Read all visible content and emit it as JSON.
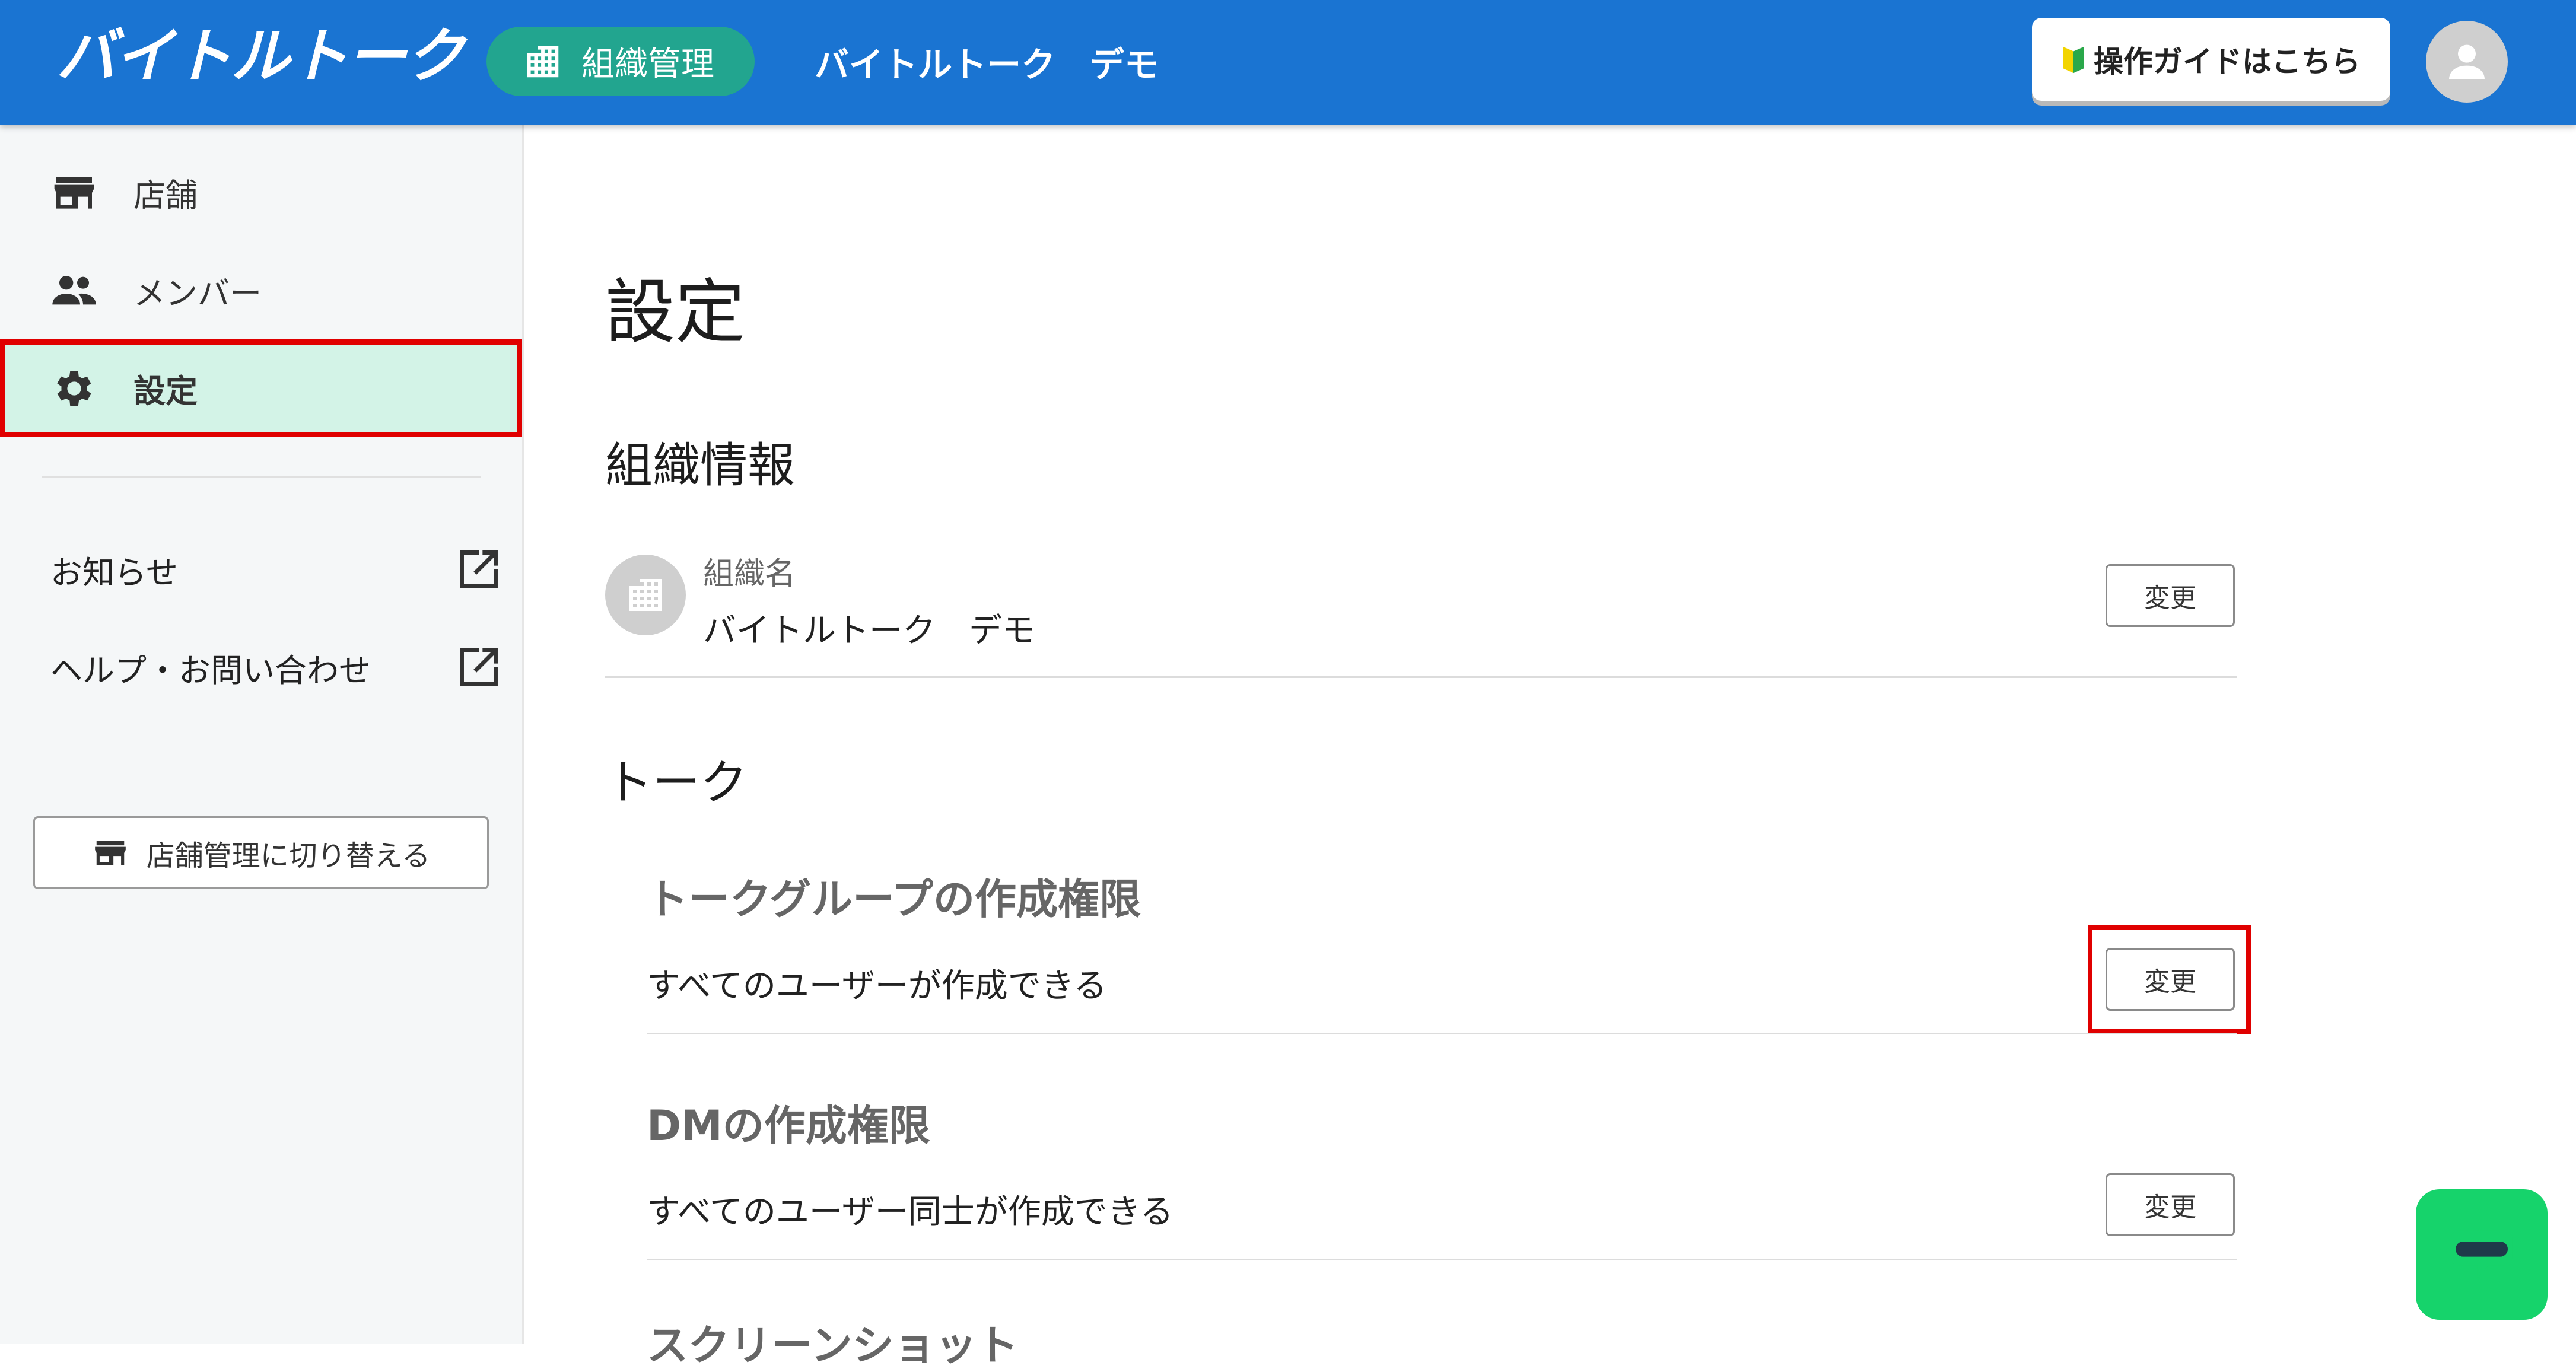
{
  "header": {
    "logo_text": "バイトルトーク",
    "org_pill_label": "組織管理",
    "org_name": "バイトルトーク　デモ",
    "guide_button_label": "操作ガイドはこちら"
  },
  "sidebar": {
    "items": [
      {
        "label": "店舗",
        "icon": "store-icon"
      },
      {
        "label": "メンバー",
        "icon": "people-icon"
      },
      {
        "label": "設定",
        "icon": "gear-icon",
        "active": true
      }
    ],
    "external_links": [
      {
        "label": "お知らせ",
        "icon": "external-link-icon"
      },
      {
        "label": "ヘルプ・お問い合わせ",
        "icon": "external-link-icon"
      }
    ],
    "switch_button_label": "店舗管理に切り替える"
  },
  "main": {
    "page_title": "設定",
    "org_section": {
      "title": "組織情報",
      "field_label": "組織名",
      "field_value": "バイトルトーク　デモ",
      "change_label": "変更"
    },
    "talk_section": {
      "title": "トーク",
      "group_permission": {
        "title": "トークグループの作成権限",
        "value": "すべてのユーザーが作成できる",
        "change_label": "変更"
      },
      "dm_permission": {
        "title": "DMの作成権限",
        "value": "すべてのユーザー同士が作成できる",
        "change_label": "変更"
      },
      "screenshot_title_partial": "スクリーンショット"
    }
  },
  "colors": {
    "header_bg": "#1a74d2",
    "pill_bg": "#22a58f",
    "active_bg": "#d3f3e7",
    "highlight": "#e00000",
    "chat_button": "#16d36b"
  }
}
